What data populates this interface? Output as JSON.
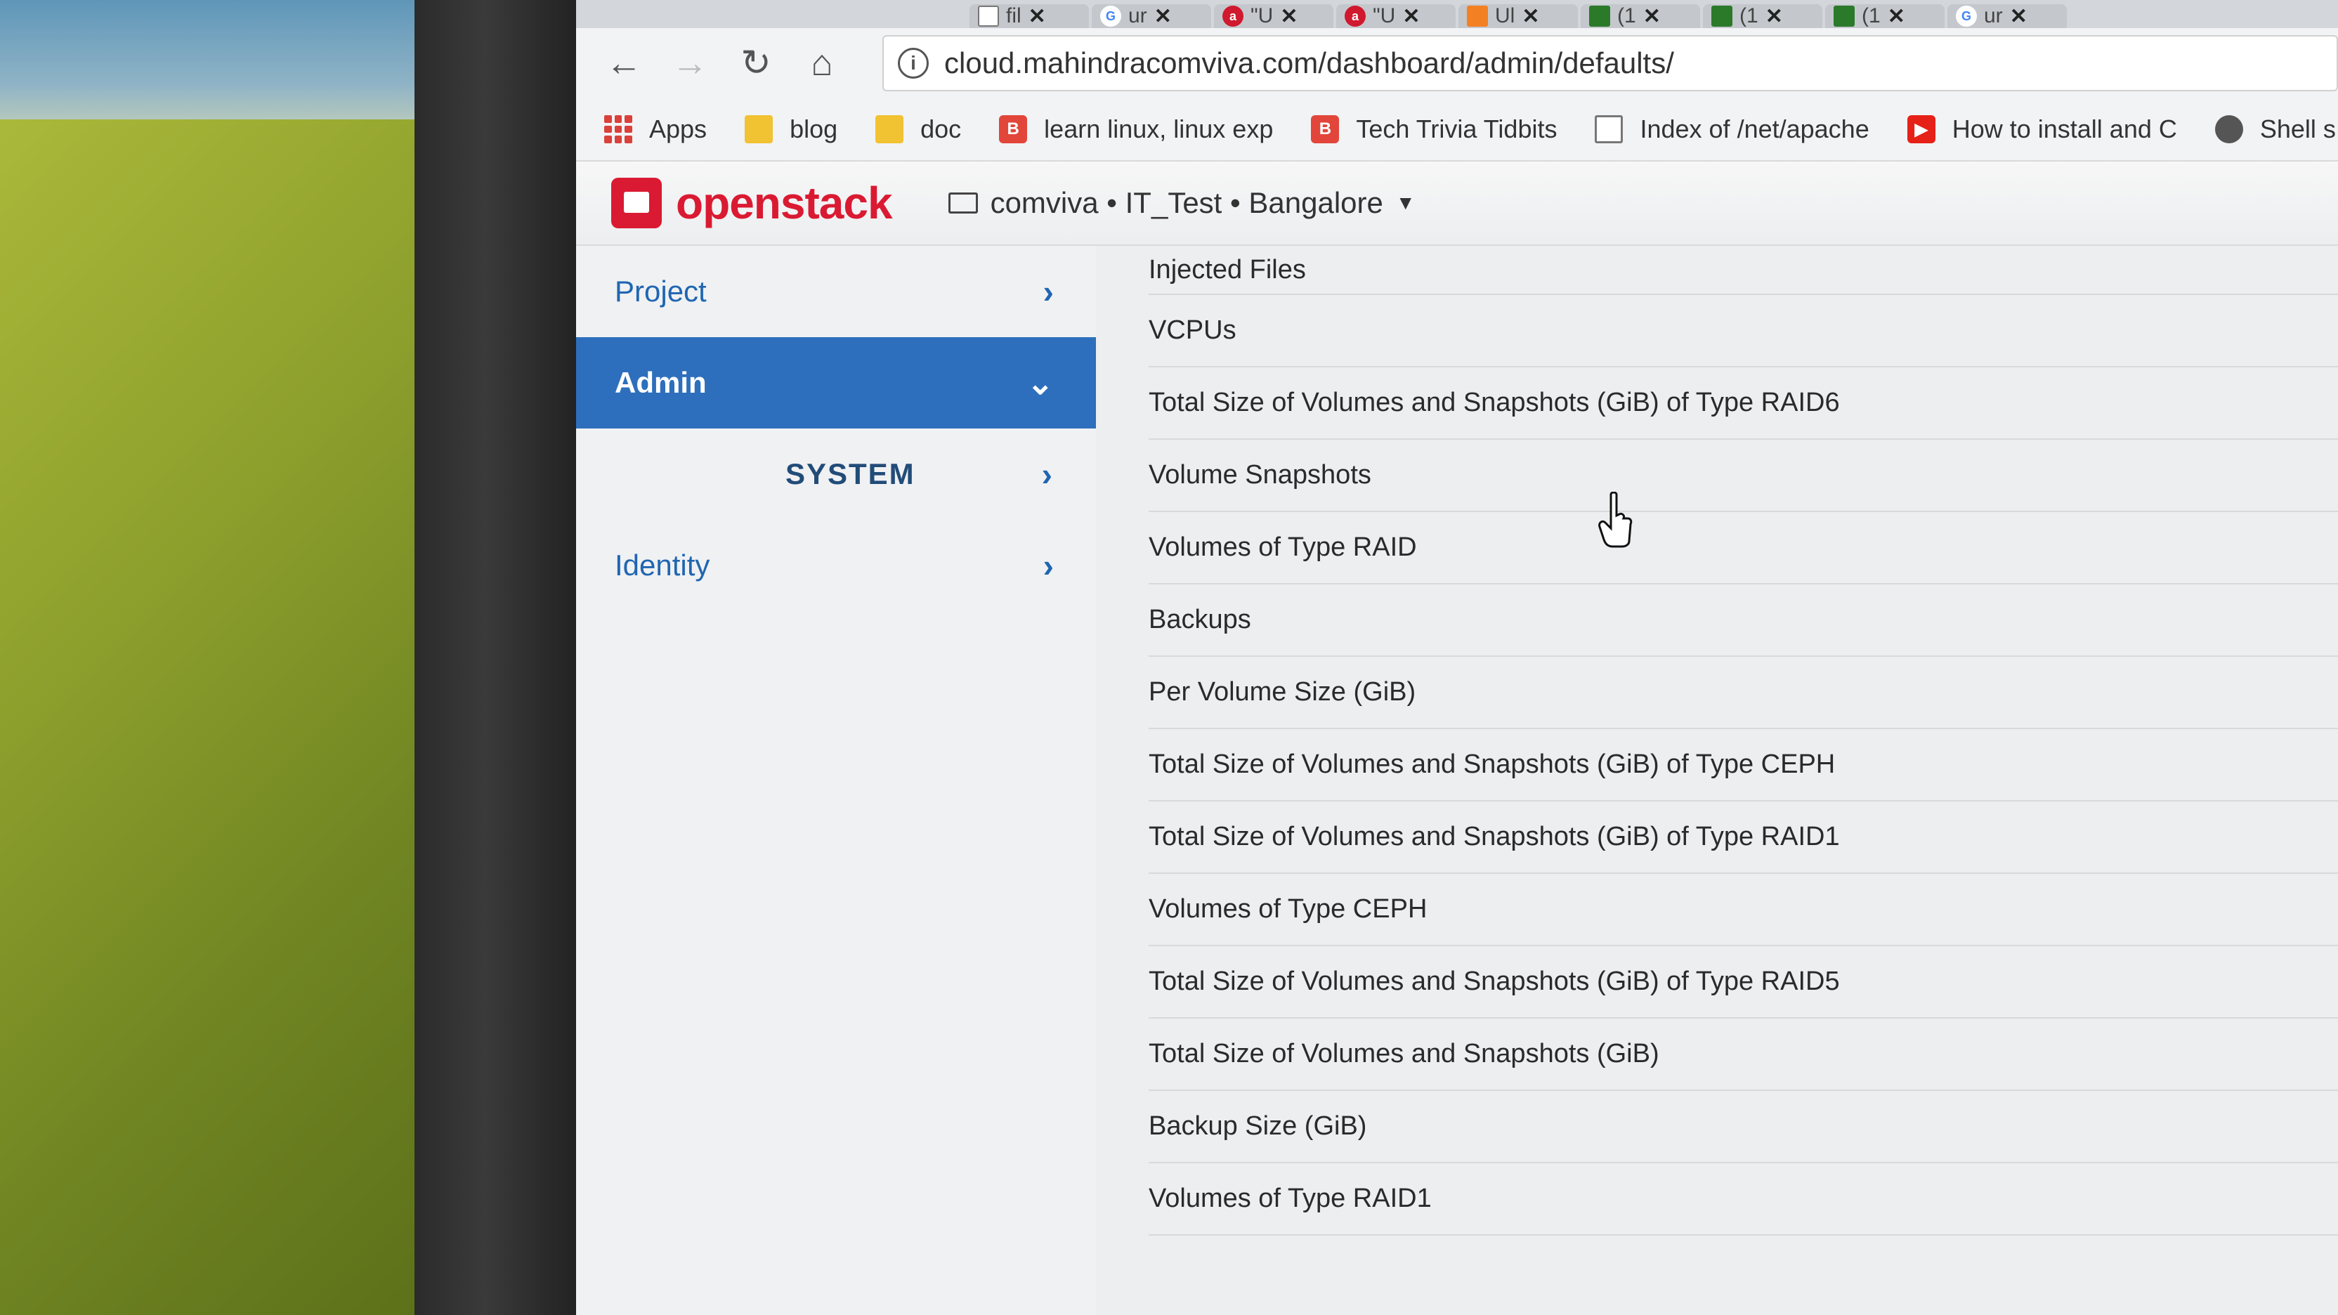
{
  "browser": {
    "tabs": [
      {
        "icon": "file-icon",
        "label": "fil"
      },
      {
        "icon": "google-icon",
        "label": "ur"
      },
      {
        "icon": "ask-icon",
        "label": "\"U"
      },
      {
        "icon": "ask-icon",
        "label": "\"U"
      },
      {
        "icon": "stack-overflow-icon",
        "label": "Ul"
      },
      {
        "icon": "superuser-icon",
        "label": "(1"
      },
      {
        "icon": "superuser-icon",
        "label": "(1"
      },
      {
        "icon": "superuser-icon",
        "label": "(1"
      },
      {
        "icon": "google-icon",
        "label": "ur"
      }
    ],
    "url": "cloud.mahindracomviva.com/dashboard/admin/defaults/",
    "bookmarks": [
      {
        "icon": "apps-grid-icon",
        "label": "Apps"
      },
      {
        "icon": "folder-icon",
        "label": "blog"
      },
      {
        "icon": "folder-icon",
        "label": "doc"
      },
      {
        "icon": "blogger-icon",
        "label": "learn linux, linux exp"
      },
      {
        "icon": "blogger-icon",
        "label": "Tech Trivia Tidbits"
      },
      {
        "icon": "page-icon",
        "label": "Index of /net/apache"
      },
      {
        "icon": "youtube-icon",
        "label": "How to install and C"
      },
      {
        "icon": "shell-icon",
        "label": "Shell s"
      }
    ]
  },
  "header": {
    "brand": "openstack",
    "context": "comviva • IT_Test • Bangalore"
  },
  "sidebar": {
    "items": [
      {
        "label": "Project"
      },
      {
        "label": "Admin"
      },
      {
        "label": "SYSTEM"
      },
      {
        "label": "Identity"
      }
    ]
  },
  "quotas": [
    "Injected Files",
    "VCPUs",
    "Total Size of Volumes and Snapshots (GiB) of Type RAID6",
    "Volume Snapshots",
    "Volumes of Type RAID",
    "Backups",
    "Per Volume Size (GiB)",
    "Total Size of Volumes and Snapshots (GiB) of Type CEPH",
    "Total Size of Volumes and Snapshots (GiB) of Type RAID1",
    "Volumes of Type CEPH",
    "Total Size of Volumes and Snapshots (GiB) of Type RAID5",
    "Total Size of Volumes and Snapshots (GiB)",
    "Backup Size (GiB)",
    "Volumes of Type RAID1"
  ],
  "colors": {
    "brand_red": "#da1a32",
    "nav_active": "#2d6fbc",
    "nav_link": "#1f66b1"
  }
}
